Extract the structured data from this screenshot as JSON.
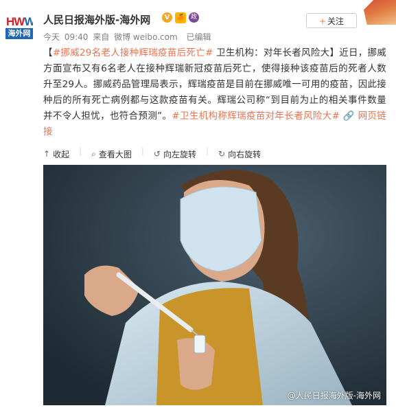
{
  "logo": {
    "top_text_1": "HW",
    "top_text_2": "W",
    "bottom_text": "海外网"
  },
  "account": {
    "name": "人民日报海外版-海外网",
    "badge_v": "V",
    "badge_2": "🍊",
    "badge_3": "政"
  },
  "meta": {
    "day": "今天",
    "time": "09:40",
    "from_label": "来自",
    "source": "微博 weibo.com",
    "edited": "已编辑"
  },
  "follow": {
    "plus": "+",
    "label": "关注"
  },
  "post": {
    "bracket_open": "【",
    "topic_link": "#挪威29名老人接种辉瑞疫苗后死亡#",
    "headline": " 卫生机构：对年长者风险大】",
    "body": "近日，挪威方面宣布又有6名老人在接种辉瑞新冠疫苗后死亡，使得接种该疫苗后的死者人数升至29人。挪威药品管理局表示，辉瑞疫苗是目前在挪威唯一可用的疫苗，因此接种后的所有死亡病例都与这款疫苗有关。辉瑞公司称“到目前为止的相关事件数量并不令人担忧，也符合预测”。",
    "hashtag": "#卫生机构称辉瑞疫苗对年长者风险大#",
    "web_icon": "🔗",
    "web_link": "网页链接"
  },
  "toolbar": {
    "collapse": "收起",
    "view_large": "查看大图",
    "rotate_left": "向左旋转",
    "rotate_right": "向右旋转"
  },
  "photo": {
    "watermark": "@人民日报海外版-海外网"
  },
  "colors": {
    "link": "#eb7350",
    "logo_red": "#d91f26",
    "logo_blue": "#1f66b3",
    "text": "#333333",
    "meta": "#808080"
  }
}
